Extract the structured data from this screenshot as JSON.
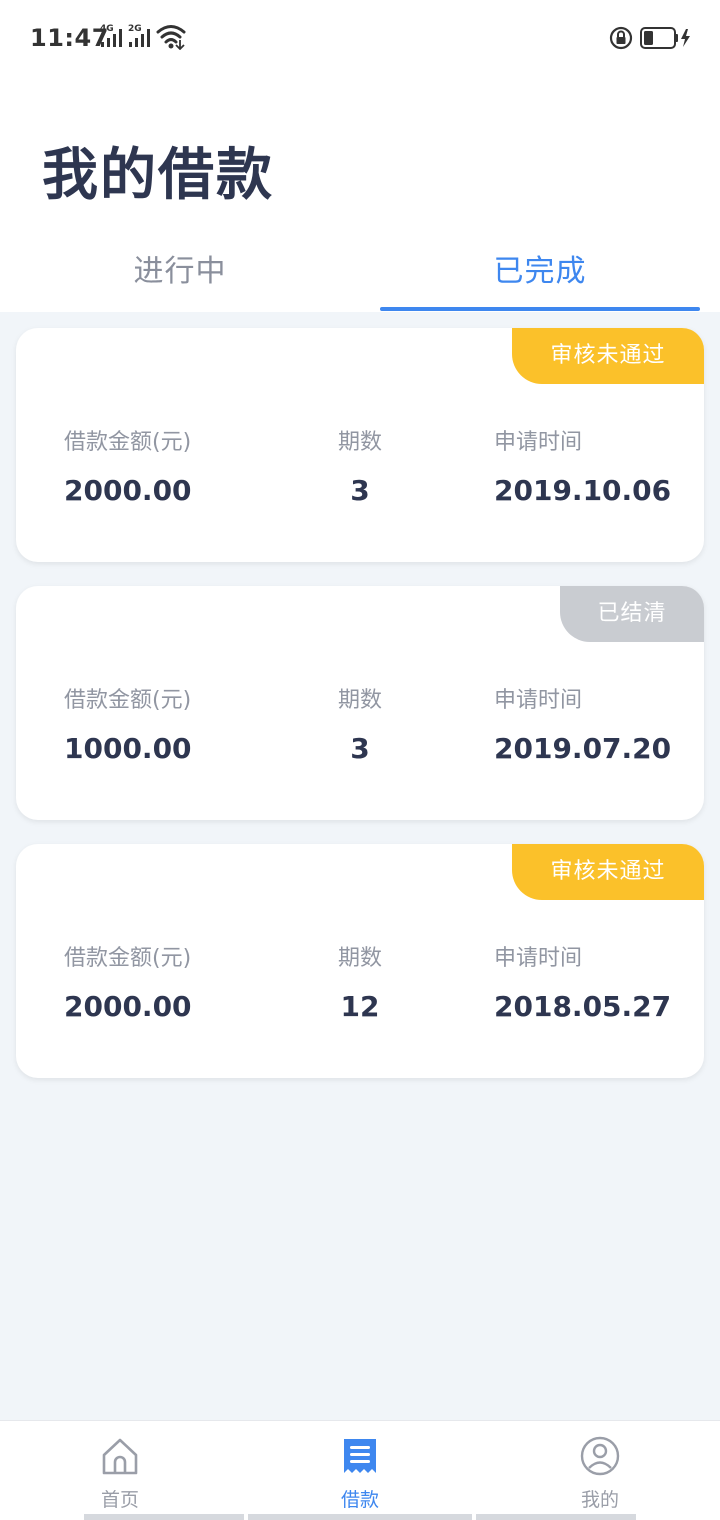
{
  "status_bar": {
    "time": "11:47",
    "network_1": "4G",
    "network_2": "2G",
    "icons": [
      "signal-icon",
      "signal-icon",
      "wifi-icon",
      "lock-rotation-icon",
      "battery-charging-icon"
    ]
  },
  "page": {
    "title": "我的借款"
  },
  "tabs": [
    {
      "label": "进行中",
      "active": false
    },
    {
      "label": "已完成",
      "active": true
    }
  ],
  "loans": [
    {
      "status": "审核未通过",
      "status_color": "#fbc12a",
      "amount_label": "借款金额(元)",
      "amount": "2000.00",
      "periods_label": "期数",
      "periods": "3",
      "date_label": "申请时间",
      "date": "2019.10.06"
    },
    {
      "status": "已结清",
      "status_color": "#c9ccd1",
      "amount_label": "借款金额(元)",
      "amount": "1000.00",
      "periods_label": "期数",
      "periods": "3",
      "date_label": "申请时间",
      "date": "2019.07.20"
    },
    {
      "status": "审核未通过",
      "status_color": "#fbc12a",
      "amount_label": "借款金额(元)",
      "amount": "2000.00",
      "periods_label": "期数",
      "periods": "12",
      "date_label": "申请时间",
      "date": "2018.05.27"
    }
  ],
  "bottom_nav": [
    {
      "label": "首页",
      "icon": "home-icon",
      "active": false
    },
    {
      "label": "借款",
      "icon": "receipt-icon",
      "active": true
    },
    {
      "label": "我的",
      "icon": "profile-icon",
      "active": false
    }
  ],
  "colors": {
    "accent": "#3e87ef",
    "title": "#2e3650",
    "background": "#f1f5f9"
  }
}
